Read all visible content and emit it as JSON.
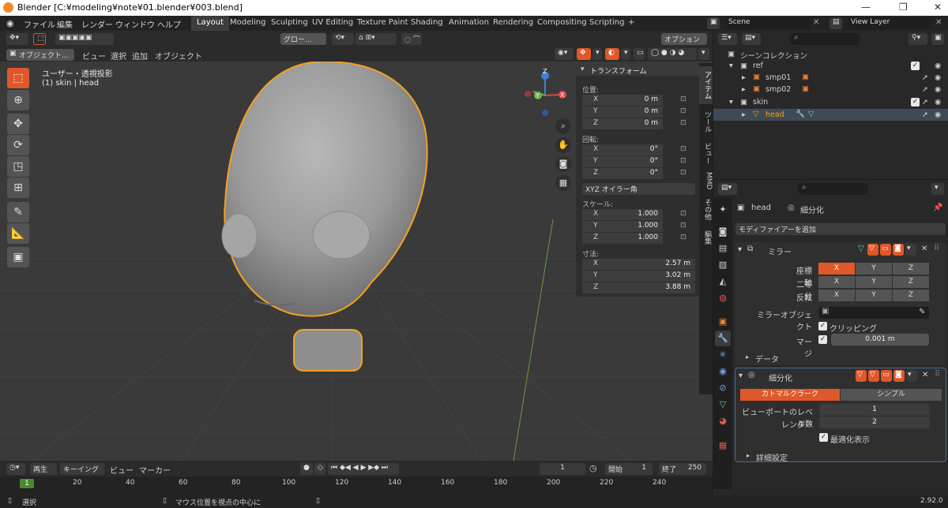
{
  "window": {
    "title": "Blender [C:¥modeling¥note¥01.blender¥003.blend]",
    "minimize": "—",
    "restore": "❐",
    "close": "✕"
  },
  "menu": [
    "ファイル",
    "編集",
    "レンダー",
    "ウィンドウ",
    "ヘルプ"
  ],
  "workspaces": [
    "Layout",
    "Modeling",
    "Sculpting",
    "UV Editing",
    "Texture Paint",
    "Shading",
    "Animation",
    "Rendering",
    "Compositing",
    "Scripting"
  ],
  "workspace_add": "+",
  "scene": {
    "name": "Scene",
    "view_layer": "View Layer"
  },
  "viewport_header": {
    "transform_orientation": "グロー...",
    "options": "オプション",
    "mode": "オブジェクト...",
    "menus": [
      "ビュー",
      "選択",
      "追加",
      "オブジェクト"
    ]
  },
  "viewport": {
    "view_name": "ユーザー・透視投影",
    "collection_info": "(1) skin | head"
  },
  "gizmo": {
    "x": "X",
    "y": "Y",
    "z": "Z"
  },
  "npanel": {
    "title": "トランスフォーム",
    "location_label": "位置:",
    "location": [
      {
        "k": "X",
        "v": "0 m"
      },
      {
        "k": "Y",
        "v": "0 m"
      },
      {
        "k": "Z",
        "v": "0 m"
      }
    ],
    "rotation_label": "回転:",
    "rotation": [
      {
        "k": "X",
        "v": "0°"
      },
      {
        "k": "Y",
        "v": "0°"
      },
      {
        "k": "Z",
        "v": "0°"
      }
    ],
    "rotation_mode": "XYZ オイラー角",
    "scale_label": "スケール:",
    "scale": [
      {
        "k": "X",
        "v": "1.000"
      },
      {
        "k": "Y",
        "v": "1.000"
      },
      {
        "k": "Z",
        "v": "1.000"
      }
    ],
    "dimensions_label": "寸法:",
    "dimensions": [
      {
        "k": "X",
        "v": "2.57 m"
      },
      {
        "k": "Y",
        "v": "3.02 m"
      },
      {
        "k": "Z",
        "v": "3.88 m"
      }
    ]
  },
  "sidetabs": [
    "アイテム",
    "ツール",
    "ビュー",
    "MMD",
    "その他",
    "編集"
  ],
  "timeline": {
    "playback": "再生",
    "keying": "キーイング",
    "view": "ビュー",
    "marker": "マーカー",
    "current_frame": "1",
    "start_label": "開始",
    "start": "1",
    "end_label": "終了",
    "end": "250",
    "ticks": [
      "1",
      "20",
      "40",
      "60",
      "80",
      "100",
      "120",
      "140",
      "160",
      "180",
      "200",
      "220",
      "240"
    ]
  },
  "statusbar": {
    "select": "選択",
    "center_view": "マウス位置を視点の中心に",
    "version": "2.92.0"
  },
  "outliner": {
    "root": "シーンコレクション",
    "rows": [
      {
        "name": "ref",
        "level": 1
      },
      {
        "name": "smp01",
        "level": 2
      },
      {
        "name": "smp02",
        "level": 2
      },
      {
        "name": "skin",
        "level": 1
      },
      {
        "name": "head",
        "level": 2
      }
    ]
  },
  "properties": {
    "object": "head",
    "modifier_name": "細分化",
    "add_modifier": "モディファイアーを追加",
    "mirror": {
      "name": "ミラー",
      "axis_label": "座標軸",
      "bisect_label": "二等分",
      "flip_label": "反転",
      "axes": [
        "X",
        "Y",
        "Z"
      ],
      "mirror_object_label": "ミラーオブジェクト",
      "clipping_label": "クリッピング",
      "merge_label": "マージ",
      "merge_value": "0.001 m",
      "data_label": "データ"
    },
    "subsurf": {
      "name": "細分化",
      "catmull": "カトマルクラーク",
      "simple": "シンプル",
      "viewport_label": "ビューポートのレベル数",
      "viewport_value": "1",
      "render_label": "レンダー",
      "render_value": "2",
      "optimal_label": "最適化表示",
      "advanced_label": "詳細設定"
    }
  },
  "colors": {
    "accent": "#e0582a",
    "selection_outline": "#f5a020",
    "selected_row": "#3f4a56"
  }
}
